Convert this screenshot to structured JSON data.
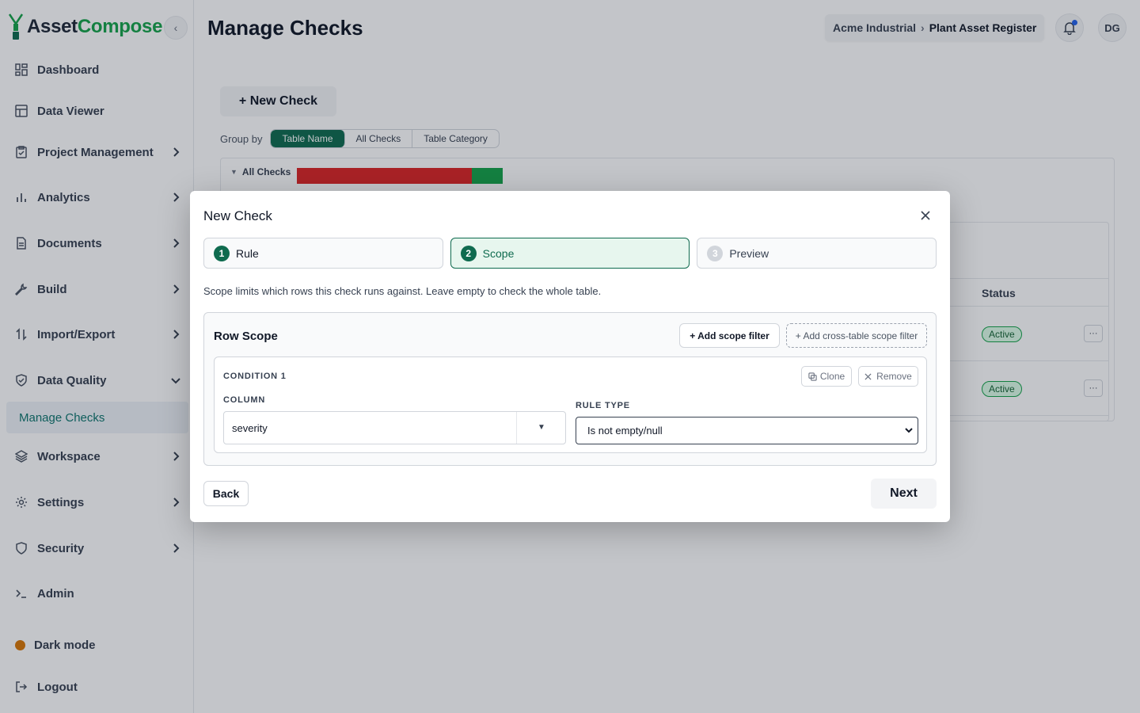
{
  "app": {
    "logo_part1": "Asset",
    "logo_part2": "Compose",
    "brand_color": "#16a34a",
    "accent_color": "#0f6b4f"
  },
  "sidebar": {
    "items": [
      {
        "label": "Dashboard",
        "icon": "dashboard-icon"
      },
      {
        "label": "Data Viewer",
        "icon": "table-icon"
      },
      {
        "label": "Project Management",
        "icon": "clipboard-icon"
      },
      {
        "label": "Analytics",
        "icon": "bar-chart-icon"
      },
      {
        "label": "Documents",
        "icon": "document-icon"
      },
      {
        "label": "Build",
        "icon": "wrench-icon"
      },
      {
        "label": "Import/Export",
        "icon": "import-export-icon"
      },
      {
        "label": "Data Quality",
        "icon": "shield-check-icon"
      },
      {
        "label": "Workspace",
        "icon": "layers-icon"
      },
      {
        "label": "Settings",
        "icon": "gear-icon"
      },
      {
        "label": "Security",
        "icon": "shield-icon"
      },
      {
        "label": "Admin",
        "icon": "terminal-icon"
      }
    ],
    "sub_item": "Manage Checks",
    "dark_mode": "Dark mode",
    "logout": "Logout"
  },
  "header": {
    "title": "Manage Checks",
    "breadcrumb": [
      "Acme Industrial",
      "Plant Asset Register"
    ],
    "breadcrumb_sep": "›",
    "avatar_initials": "DG"
  },
  "main": {
    "new_check_label": "+ New Check",
    "group_by_label": "Group by",
    "group_options": [
      "Table Name",
      "All Checks",
      "Table Category"
    ],
    "group_selected": "Table Name",
    "panel_header": "All Checks",
    "status_header": "Status",
    "rows": [
      {
        "status": "Active",
        "more": "···"
      },
      {
        "status": "Active",
        "more": "···"
      }
    ]
  },
  "modal": {
    "title": "New Check",
    "steps": [
      {
        "num": "1",
        "label": "Rule"
      },
      {
        "num": "2",
        "label": "Scope"
      },
      {
        "num": "3",
        "label": "Preview"
      }
    ],
    "active_step": 2,
    "scope_note": "Scope limits which rows this check runs against. Leave empty to check the whole table.",
    "row_scope_title": "Row Scope",
    "add_scope_label": "+ Add scope filter",
    "add_cross_label": "+ Add cross-table scope filter",
    "condition": {
      "label": "CONDITION 1",
      "clone_label": "Clone",
      "remove_label": "Remove",
      "column_label": "COLUMN",
      "column_value": "severity",
      "rule_type_label": "RULE TYPE",
      "rule_type_value": "Is not empty/null"
    },
    "back_label": "Back",
    "next_label": "Next"
  }
}
